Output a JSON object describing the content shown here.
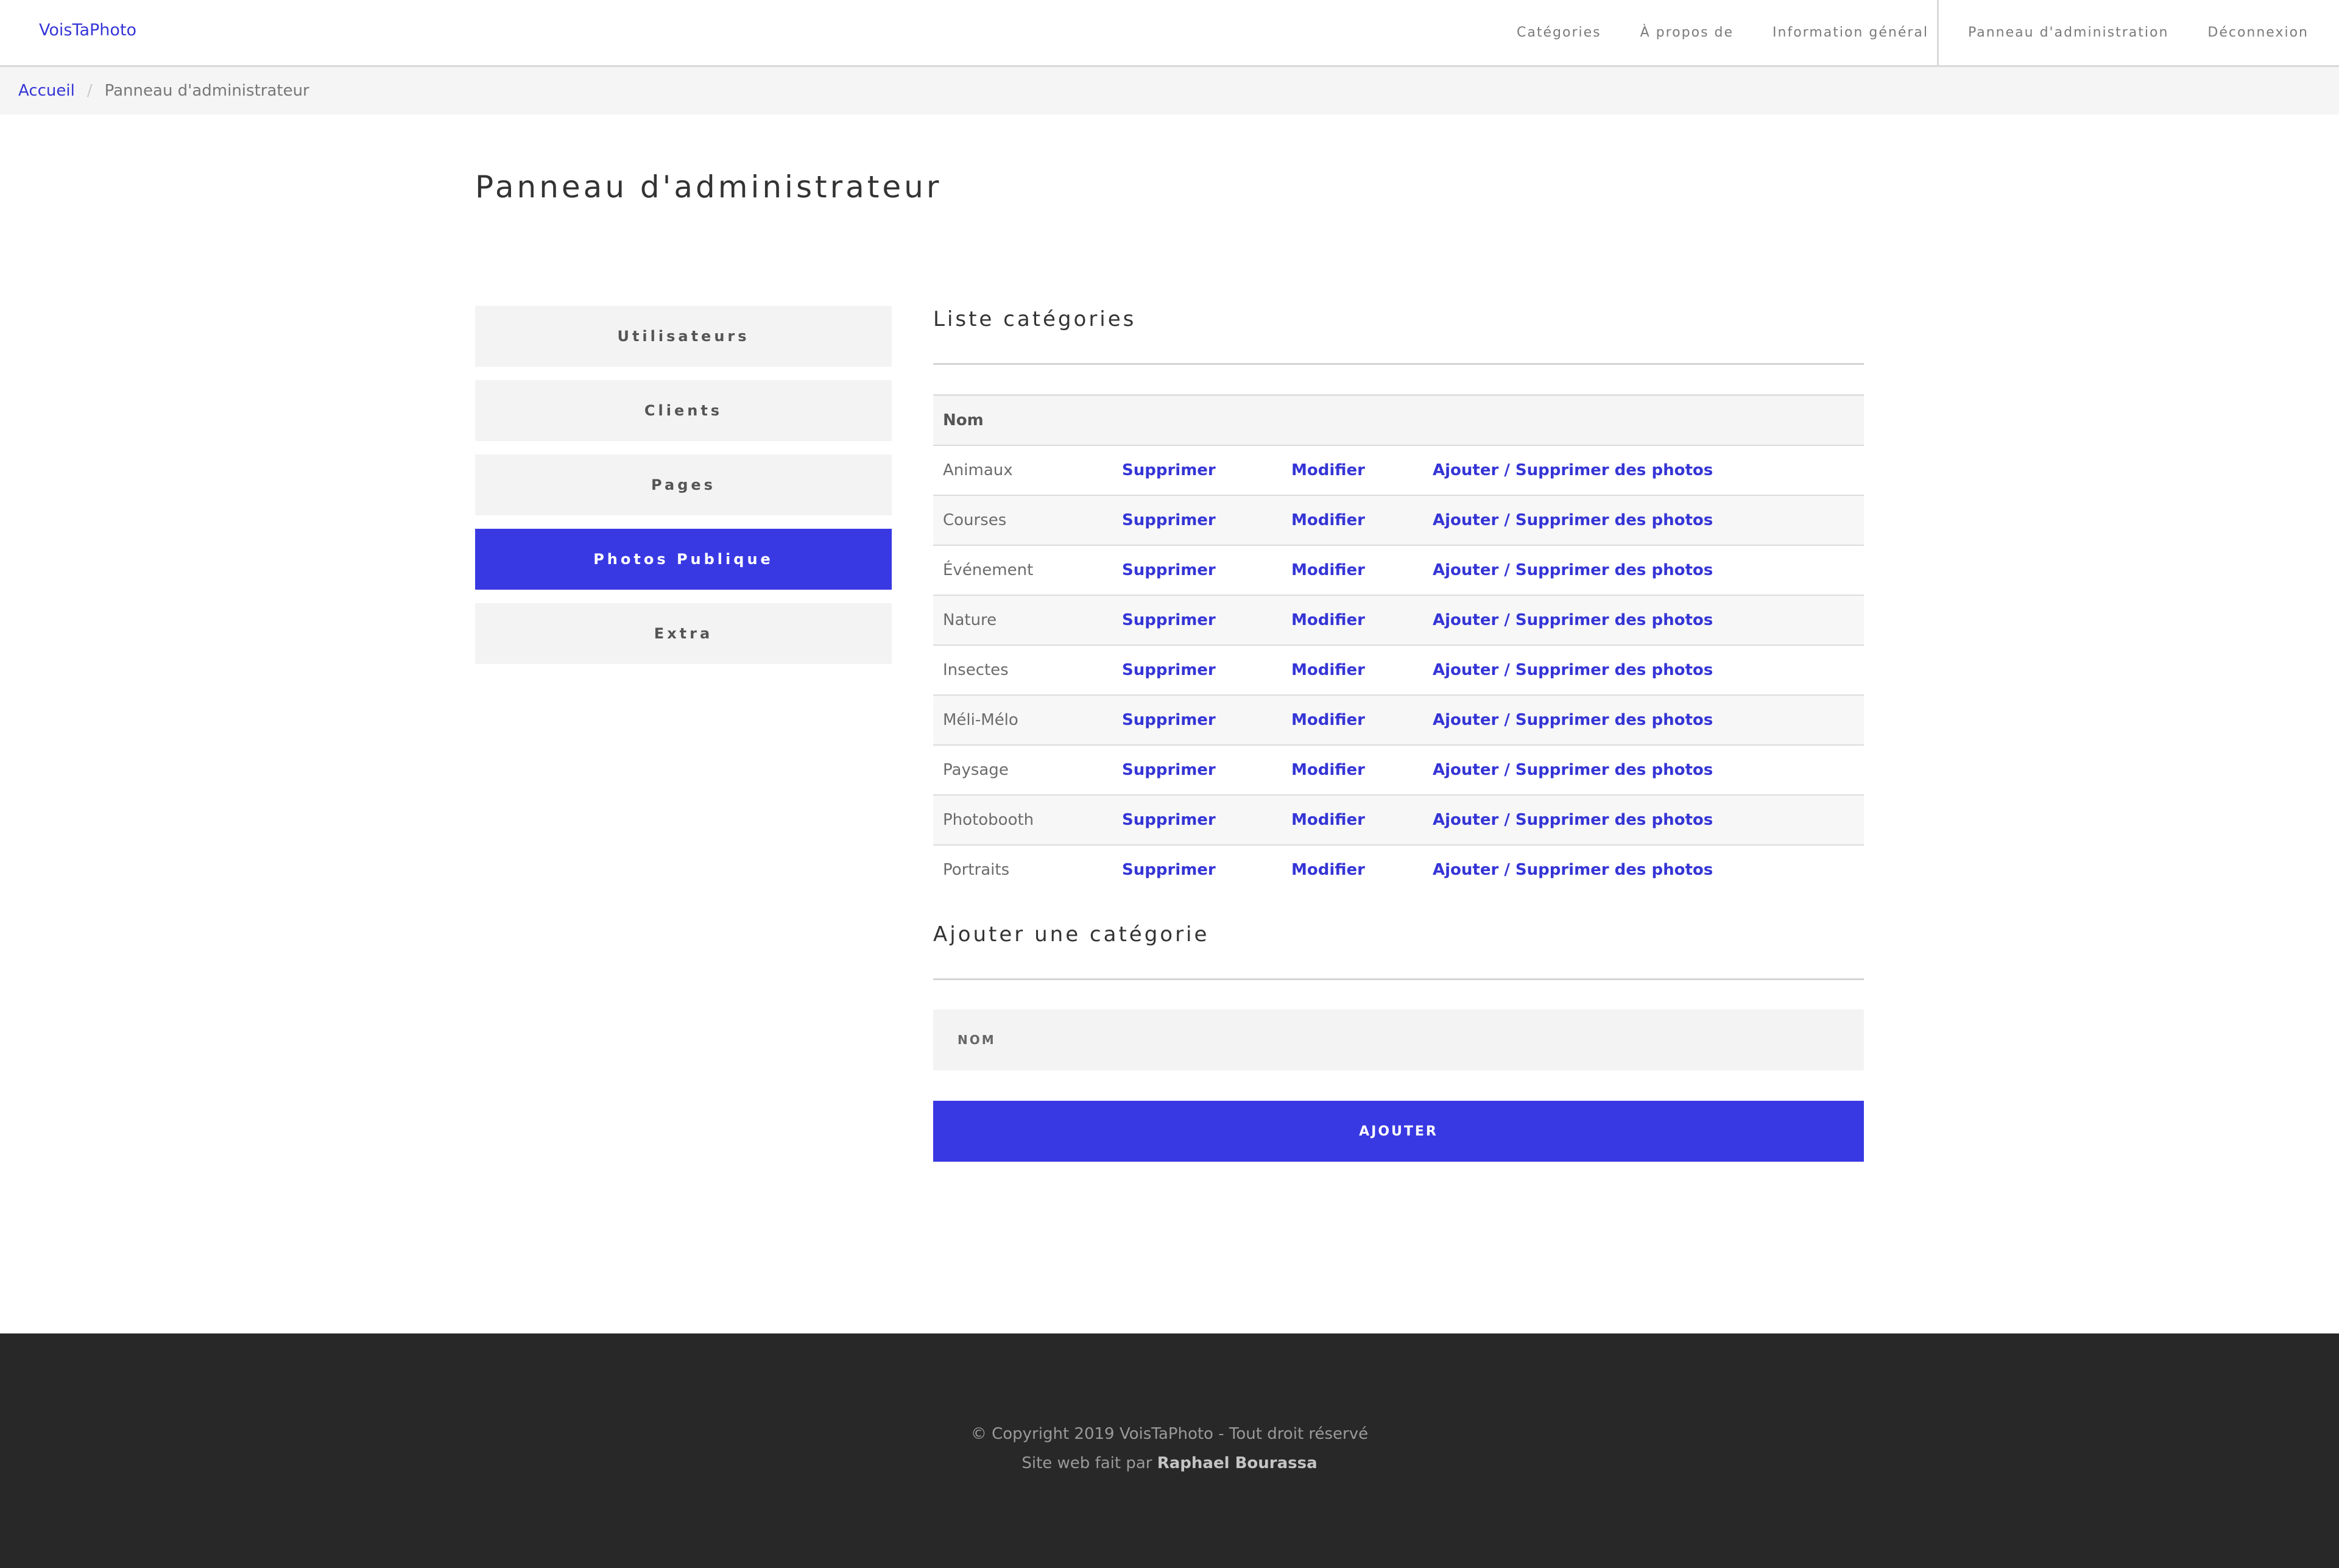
{
  "navbar": {
    "brand": "VoisTaPhoto",
    "left_links": [
      "Catégories",
      "À propos de",
      "Information général"
    ],
    "right_links": [
      "Panneau d'administration",
      "Déconnexion"
    ]
  },
  "breadcrumb": {
    "home": "Accueil",
    "separator": "/",
    "current": "Panneau d'administrateur"
  },
  "page_title": "Panneau d'administrateur",
  "sidebar": {
    "items": [
      {
        "label": "Utilisateurs",
        "active": false
      },
      {
        "label": "Clients",
        "active": false
      },
      {
        "label": "Pages",
        "active": false
      },
      {
        "label": "Photos Publique",
        "active": true
      },
      {
        "label": "Extra",
        "active": false
      }
    ]
  },
  "categories_section": {
    "title": "Liste catégories",
    "header": "Nom",
    "action_delete": "Supprimer",
    "action_edit": "Modifier",
    "action_photos": "Ajouter / Supprimer des photos",
    "rows": [
      "Animaux",
      "Courses",
      "Événement",
      "Nature",
      "Insectes",
      "Méli-Mélo",
      "Paysage",
      "Photobooth",
      "Portraits"
    ]
  },
  "add_section": {
    "title": "Ajouter une catégorie",
    "name_placeholder": "NOM",
    "submit_label": "AJOUTER"
  },
  "footer": {
    "copyright": "© Copyright 2019 VoisTaPhoto - Tout droit réservé",
    "credit_prefix": "Site web fait par",
    "credit_author": "Raphael Bourassa"
  },
  "colors": {
    "accent": "#3939e3",
    "link": "#3535d6",
    "footer_bg": "#282828"
  }
}
